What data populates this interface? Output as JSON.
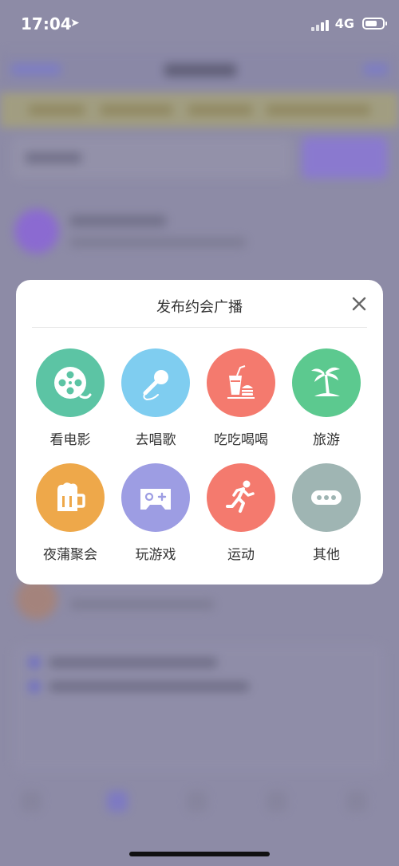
{
  "status_bar": {
    "time": "17:04",
    "network": "4G"
  },
  "modal": {
    "title": "发布约会广播",
    "categories": [
      {
        "label": "看电影",
        "icon": "film-reel-icon",
        "color": "#5cc4a4"
      },
      {
        "label": "去唱歌",
        "icon": "microphone-icon",
        "color": "#7fcdf0"
      },
      {
        "label": "吃吃喝喝",
        "icon": "food-drink-icon",
        "color": "#f47a6e"
      },
      {
        "label": "旅游",
        "icon": "palm-tree-icon",
        "color": "#5cc98f"
      },
      {
        "label": "夜蒲聚会",
        "icon": "beer-mug-icon",
        "color": "#eea84a"
      },
      {
        "label": "玩游戏",
        "icon": "gamepad-icon",
        "color": "#9d9de3"
      },
      {
        "label": "运动",
        "icon": "running-person-icon",
        "color": "#f47a6e"
      },
      {
        "label": "其他",
        "icon": "more-dots-icon",
        "color": "#9fb5b3"
      }
    ]
  }
}
